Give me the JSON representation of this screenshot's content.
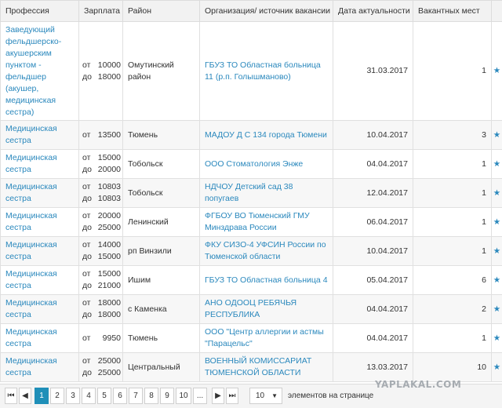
{
  "headers": [
    "Профессия",
    "Зарплата",
    "Район",
    "Организация/ источник вакансии",
    "Дата актуальности",
    "Вакантных мест"
  ],
  "rows": [
    {
      "profession": "Заведующий фельдшерско-акушерским пунктом - фельдшер (акушер, медицинская сестра)",
      "sal_from_label": "от",
      "sal_from": "10000",
      "sal_to_label": "до",
      "sal_to": "18000",
      "district": "Омутинский район",
      "org": "ГБУЗ ТО Областная больница 11 (р.п. Голышманово)",
      "date": "31.03.2017",
      "vacancies": "1"
    },
    {
      "profession": "Медицинская сестра",
      "sal_from_label": "от",
      "sal_from": "13500",
      "sal_to_label": "",
      "sal_to": "",
      "district": "Тюмень",
      "org": "МАДОУ Д С 134 города Тюмени",
      "date": "10.04.2017",
      "vacancies": "3"
    },
    {
      "profession": "Медицинская сестра",
      "sal_from_label": "от",
      "sal_from": "15000",
      "sal_to_label": "до",
      "sal_to": "20000",
      "district": "Тобольск",
      "org": "ООО Стоматология Энже",
      "date": "04.04.2017",
      "vacancies": "1"
    },
    {
      "profession": "Медицинская сестра",
      "sal_from_label": "от",
      "sal_from": "10803",
      "sal_to_label": "до",
      "sal_to": "10803",
      "district": "Тобольск",
      "org": "НДЧОУ Детский сад 38 попугаев",
      "date": "12.04.2017",
      "vacancies": "1"
    },
    {
      "profession": "Медицинская сестра",
      "sal_from_label": "от",
      "sal_from": "20000",
      "sal_to_label": "до",
      "sal_to": "25000",
      "district": "Ленинский",
      "org": "ФГБОУ ВО Тюменский ГМУ Минздрава России",
      "date": "06.04.2017",
      "vacancies": "1"
    },
    {
      "profession": "Медицинская сестра",
      "sal_from_label": "от",
      "sal_from": "14000",
      "sal_to_label": "до",
      "sal_to": "15000",
      "district": "рп Винзили",
      "org": "ФКУ СИЗО-4 УФСИН России по Тюменской области",
      "date": "10.04.2017",
      "vacancies": "1"
    },
    {
      "profession": "Медицинская сестра",
      "sal_from_label": "от",
      "sal_from": "15000",
      "sal_to_label": "до",
      "sal_to": "21000",
      "district": "Ишим",
      "org": "ГБУЗ ТО Областная больница 4",
      "date": "05.04.2017",
      "vacancies": "6"
    },
    {
      "profession": "Медицинская сестра",
      "sal_from_label": "от",
      "sal_from": "18000",
      "sal_to_label": "до",
      "sal_to": "18000",
      "district": "с Каменка",
      "org": "АНО ОДООЦ РЕБЯЧЬЯ РЕСПУБЛИКА",
      "date": "04.04.2017",
      "vacancies": "2"
    },
    {
      "profession": "Медицинская сестра",
      "sal_from_label": "от",
      "sal_from": "9950",
      "sal_to_label": "",
      "sal_to": "",
      "district": "Тюмень",
      "org": "ООО \"Центр аллергии и астмы \"Парацельс\"",
      "date": "04.04.2017",
      "vacancies": "1"
    },
    {
      "profession": "Медицинская сестра",
      "sal_from_label": "от",
      "sal_from": "25000",
      "sal_to_label": "до",
      "sal_to": "25000",
      "district": "Центральный",
      "org": "ВОЕННЫЙ КОМИССАРИАТ ТЮМЕНСКОЙ ОБЛАСТИ",
      "date": "13.03.2017",
      "vacancies": "10"
    }
  ],
  "star_glyph": "★",
  "pager": {
    "first": "⏮",
    "prev": "◀",
    "pages": [
      "1",
      "2",
      "3",
      "4",
      "5",
      "6",
      "7",
      "8",
      "9",
      "10",
      "..."
    ],
    "active_page": "1",
    "next": "▶",
    "last": "⏭",
    "page_size": "10",
    "page_size_label": "элементов на странице"
  },
  "watermark": "YAPLAKAL.COM",
  "colors": {
    "link": "#2a88bd",
    "active_page": "#1f8fb8",
    "header_bg": "#f2f2f2"
  }
}
